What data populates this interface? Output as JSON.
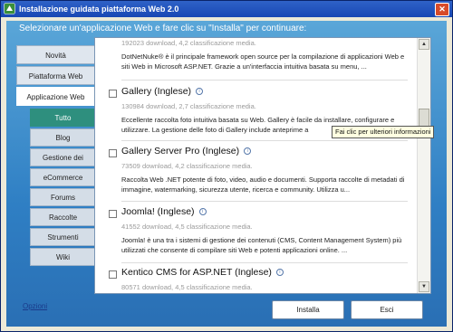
{
  "window": {
    "title": "Installazione guidata piattaforma Web 2.0",
    "close_symbol": "✕"
  },
  "heading": "Selezionare un'applicazione Web e fare clic su \"Installa\" per continuare:",
  "nav": {
    "top": [
      "Novità",
      "Piattaforma Web",
      "Applicazione Web"
    ],
    "active_top": "Applicazione Web",
    "sub": [
      "Tutto",
      "Blog",
      "Gestione dei contenuti",
      "eCommerce",
      "Forums",
      "Raccolte",
      "Strumenti",
      "Wiki"
    ],
    "active_sub": "Tutto"
  },
  "list": {
    "partial_top": {
      "meta": "192023 download, 4,2 classificazione media.",
      "desc": "DotNetNuke® è il principale framework open source per la compilazione di applicazioni Web e siti Web in Microsoft ASP.NET. Grazie a un'interfaccia intuitiva basata su menu, ..."
    },
    "items": [
      {
        "title": "Gallery (Inglese)",
        "meta": "130984 download, 2,7 classificazione media.",
        "desc": "Eccellente raccolta foto intuitiva basata su Web. Gallery è facile da installare, configurare e utilizzare. La gestione delle foto di Gallery include anteprime a"
      },
      {
        "title": "Gallery Server Pro (Inglese)",
        "meta": "73509 download, 4,2 classificazione media.",
        "desc": "Raccolta Web .NET potente di foto, video, audio e documenti. Supporta raccolte di metadati di immagine, watermarking, sicurezza utente, ricerca e community. Utilizza u..."
      },
      {
        "title": "Joomla! (Inglese)",
        "meta": "41552 download, 4,5 classificazione media.",
        "desc": "Joomla! è una tra i sistemi di gestione dei contenuti (CMS, Content Management System) più utilizzati che consente di compilare siti Web e potenti applicazioni online. ..."
      },
      {
        "title": "Kentico CMS for ASP.NET (Inglese)",
        "meta": "80571 download, 4,5 classificazione media.",
        "desc": ""
      }
    ],
    "info_glyph": "i"
  },
  "tooltip": "Fai clic per ulteriori informazioni",
  "footer": {
    "options": "Opzioni",
    "install": "Installa",
    "exit": "Esci"
  },
  "scroll": {
    "up": "▲",
    "down": "▼"
  }
}
